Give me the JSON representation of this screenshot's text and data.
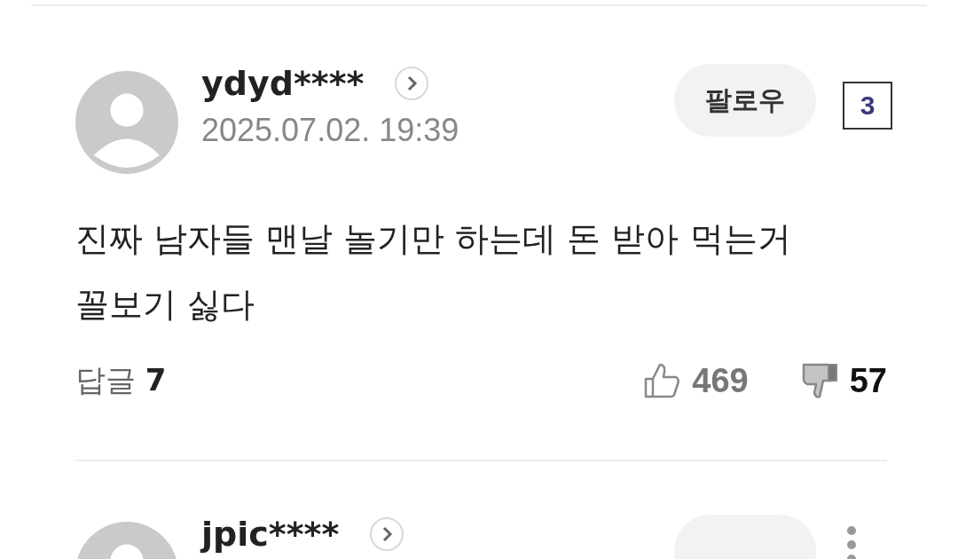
{
  "comments": [
    {
      "username": "ydyd****",
      "date": "2025.07.02. 19:39",
      "follow": "팔로우",
      "body": "진짜 남자들 맨날 놀기만 하는데 돈 받아 먹는거 꼴보기 싫다",
      "replies_label": "답글",
      "replies": "7",
      "likes": "469",
      "dislikes": "57",
      "liked": false,
      "disliked": true,
      "badge": "3"
    },
    {
      "username": "jpic****"
    }
  ]
}
